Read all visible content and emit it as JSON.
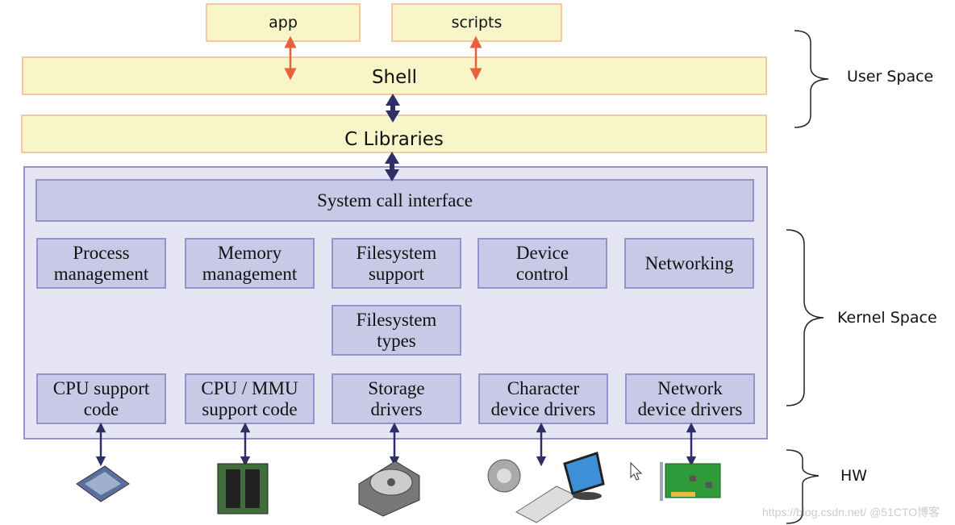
{
  "user_space": {
    "app": "app",
    "scripts": "scripts",
    "shell": "Shell",
    "c_libraries": "C Libraries"
  },
  "kernel": {
    "syscall": "System call interface",
    "row1": [
      "Process\nmanagement",
      "Memory\nmanagement",
      "Filesystem\nsupport",
      "Device\ncontrol",
      "Networking"
    ],
    "fs_types": "Filesystem\ntypes",
    "row3": [
      "CPU support\ncode",
      "CPU / MMU\nsupport code",
      "Storage\ndrivers",
      "Character\ndevice drivers",
      "Network\ndevice drivers"
    ]
  },
  "labels": {
    "user_space": "User Space",
    "kernel_space": "Kernel Space",
    "hw": "HW"
  },
  "hardware_icons": [
    "cpu-chip-icon",
    "memory-module-icon",
    "hard-disk-icon",
    "speaker-keyboard-monitor-icon",
    "network-card-icon"
  ],
  "watermark": "https://blog.csdn.net/ @51CTO博客",
  "colors": {
    "user_fill": "#f8f5c9",
    "user_border": "#f2c9a0",
    "kernel_fill": "#e5e5f3",
    "kernel_box": "#c9c8e6",
    "arrow_dark": "#2e2f66",
    "arrow_orange": "#e8603a"
  }
}
